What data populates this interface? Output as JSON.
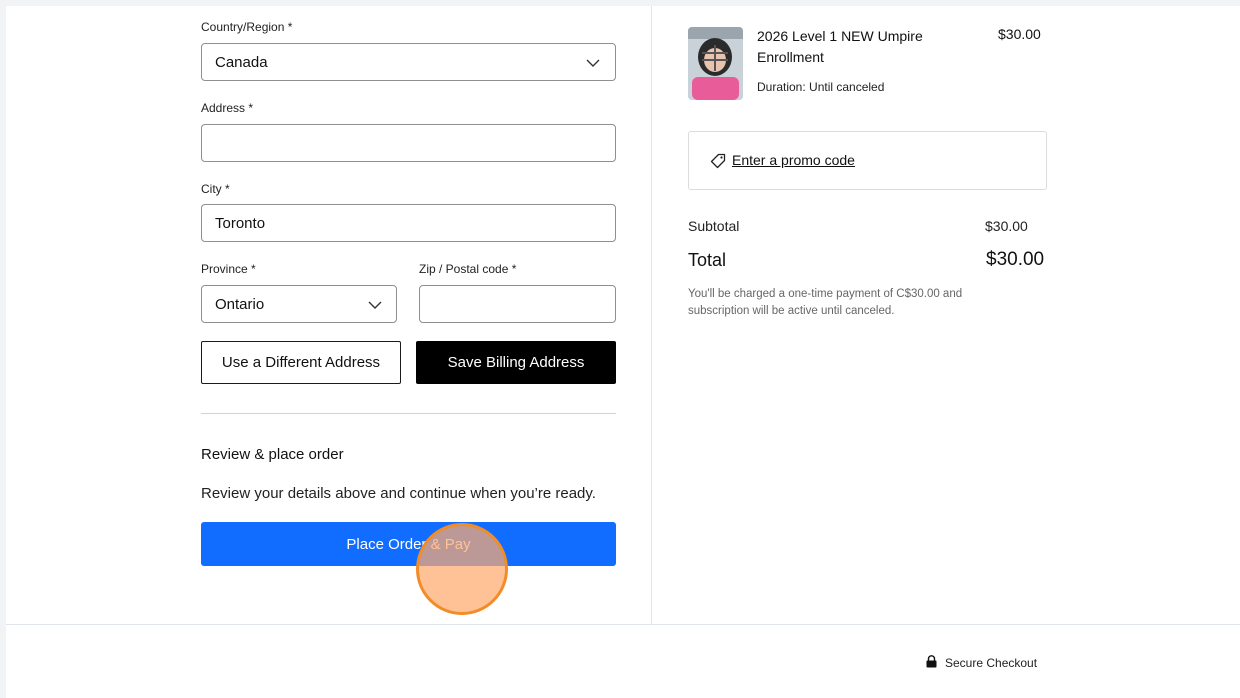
{
  "billing": {
    "country_label": "Country/Region *",
    "country_value": "Canada",
    "address_label": "Address *",
    "address_value": "",
    "city_label": "City *",
    "city_value": "Toronto",
    "province_label": "Province *",
    "province_value": "Ontario",
    "zip_label": "Zip / Postal code *",
    "zip_value": "",
    "use_different_label": "Use a Different Address",
    "save_label": "Save Billing Address"
  },
  "review": {
    "heading": "Review & place order",
    "text": "Review your details above and continue when you’re ready.",
    "place_order_label": "Place Order & Pay"
  },
  "summary": {
    "item": {
      "title_line1": "2026 Level 1 NEW Umpire",
      "title_line2": "Enrollment",
      "price": "$30.00",
      "duration": "Duration: Until canceled"
    },
    "promo_label": "Enter a promo code",
    "subtotal_label": "Subtotal",
    "subtotal_value": "$30.00",
    "total_label": "Total",
    "total_value": "$30.00",
    "note_line1": "You'll be charged a one-time payment of C$30.00 and",
    "note_line2": "subscription will be active until canceled."
  },
  "footer": {
    "secure_label": "Secure Checkout"
  },
  "colors": {
    "primary_button": "#116dff",
    "dark_button": "#000000",
    "cursor_highlight": "#f28c28"
  },
  "icons": {
    "dropdown": "chevron-down-icon",
    "promo": "tag-icon",
    "secure": "lock-icon"
  }
}
